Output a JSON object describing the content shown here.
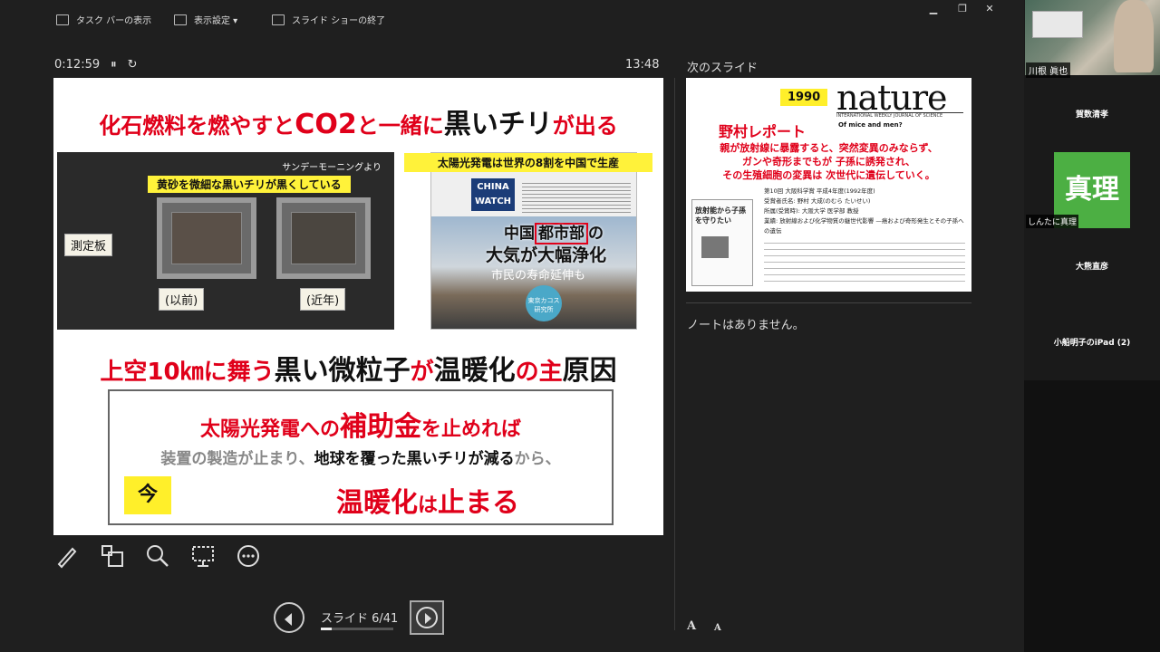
{
  "toolbar": {
    "taskbar_label": "タスク バーの表示",
    "display_settings_label": "表示設定 ▾",
    "end_show_label": "スライド ショーの終了"
  },
  "window_controls": {
    "minimize": "▁",
    "restore": "❐",
    "close": "✕"
  },
  "timer": {
    "elapsed": "0:12:59",
    "pause_icon": "⏸",
    "reset_icon": "↻",
    "clock": "13:48"
  },
  "current_slide": {
    "title_part1": "化石燃料を燃やすと",
    "title_co2": "CO2",
    "title_part2": "と一緒に",
    "title_black": "黒いチリ",
    "title_part3": "が出る",
    "photo_caption": "サンデーモーニングより",
    "photo_label": "黄砂を微細な黒いチリが黒くしている",
    "note_measure": "測定板",
    "note_before": "(以前)",
    "note_recent": "(近年)",
    "news_header": "太陽光発電は世界の8割を中国で生産",
    "news_logo": "CHINA WATCH",
    "news_h1_a": "中国",
    "news_h1_b": "都市部",
    "news_h1_c": "の",
    "news_h2": "大気が大幅浄化",
    "news_h3": "市民の寿命延伸も",
    "news_stamp": "東京カコス研究所",
    "mid_a": "上空10㎞に",
    "mid_b": "舞う",
    "mid_c": "黒い微粒子",
    "mid_d": "が",
    "mid_e": "温暖化",
    "mid_f": "の主",
    "mid_g": "原因",
    "box_line1_a": "太陽光発電への",
    "box_line1_b": "補助金",
    "box_line1_c": "を止めれば",
    "box_line2_a": "装置の製造が止まり、",
    "box_line2_b": "地球を覆った黒いチリが減る",
    "box_line2_c": "から、",
    "box_now": "今",
    "box_line3_a": "温暖化",
    "box_line3_b": "は",
    "box_line3_c": "止まる"
  },
  "navigation": {
    "slide_counter": "スライド 6/41",
    "progress": 0.146
  },
  "next_slide_label": "次のスライド",
  "next_slide": {
    "year": "1990",
    "logo": "nature",
    "logo_sub": "INTERNATIONAL WEEKLY JOURNAL OF SCIENCE",
    "article": "Of mice and men?",
    "title": "野村レポート",
    "red_line1": "親が放射線に暴露すると、突然変異のみならず、",
    "red_line2": "ガンや奇形までもが 子孫に誘発され、",
    "red_line3": "その生殖細胞の変異は 次世代に遺伝していく。",
    "info_line1": "第10回 大阪科学賞 平成4年度(1992年度)",
    "info_line2": "受賞者氏名: 野村 大成(のむら たいせい)",
    "info_line3": "所属(受賞時): 大阪大学 医学部 教授",
    "info_line4": "業績: 放射線および化学物質の継世代影響 —癌および奇形発生とその子孫への遺伝",
    "book_title": "放射能から子孫を守りたい"
  },
  "notes_text": "ノートはありません。",
  "font_buttons": {
    "increase": "A",
    "decrease": "A"
  },
  "participants": {
    "camera_name": "川根 眞也",
    "p1": "賀数清孝",
    "avatar_text": "真理",
    "avatar_name": "しんたに真理",
    "p3": "大熊直彦",
    "p4": "小船明子のiPad (2)"
  },
  "colors": {
    "accent_red": "#e0001a",
    "highlight_yellow": "#fff23a",
    "avatar_green": "#4caf43"
  }
}
